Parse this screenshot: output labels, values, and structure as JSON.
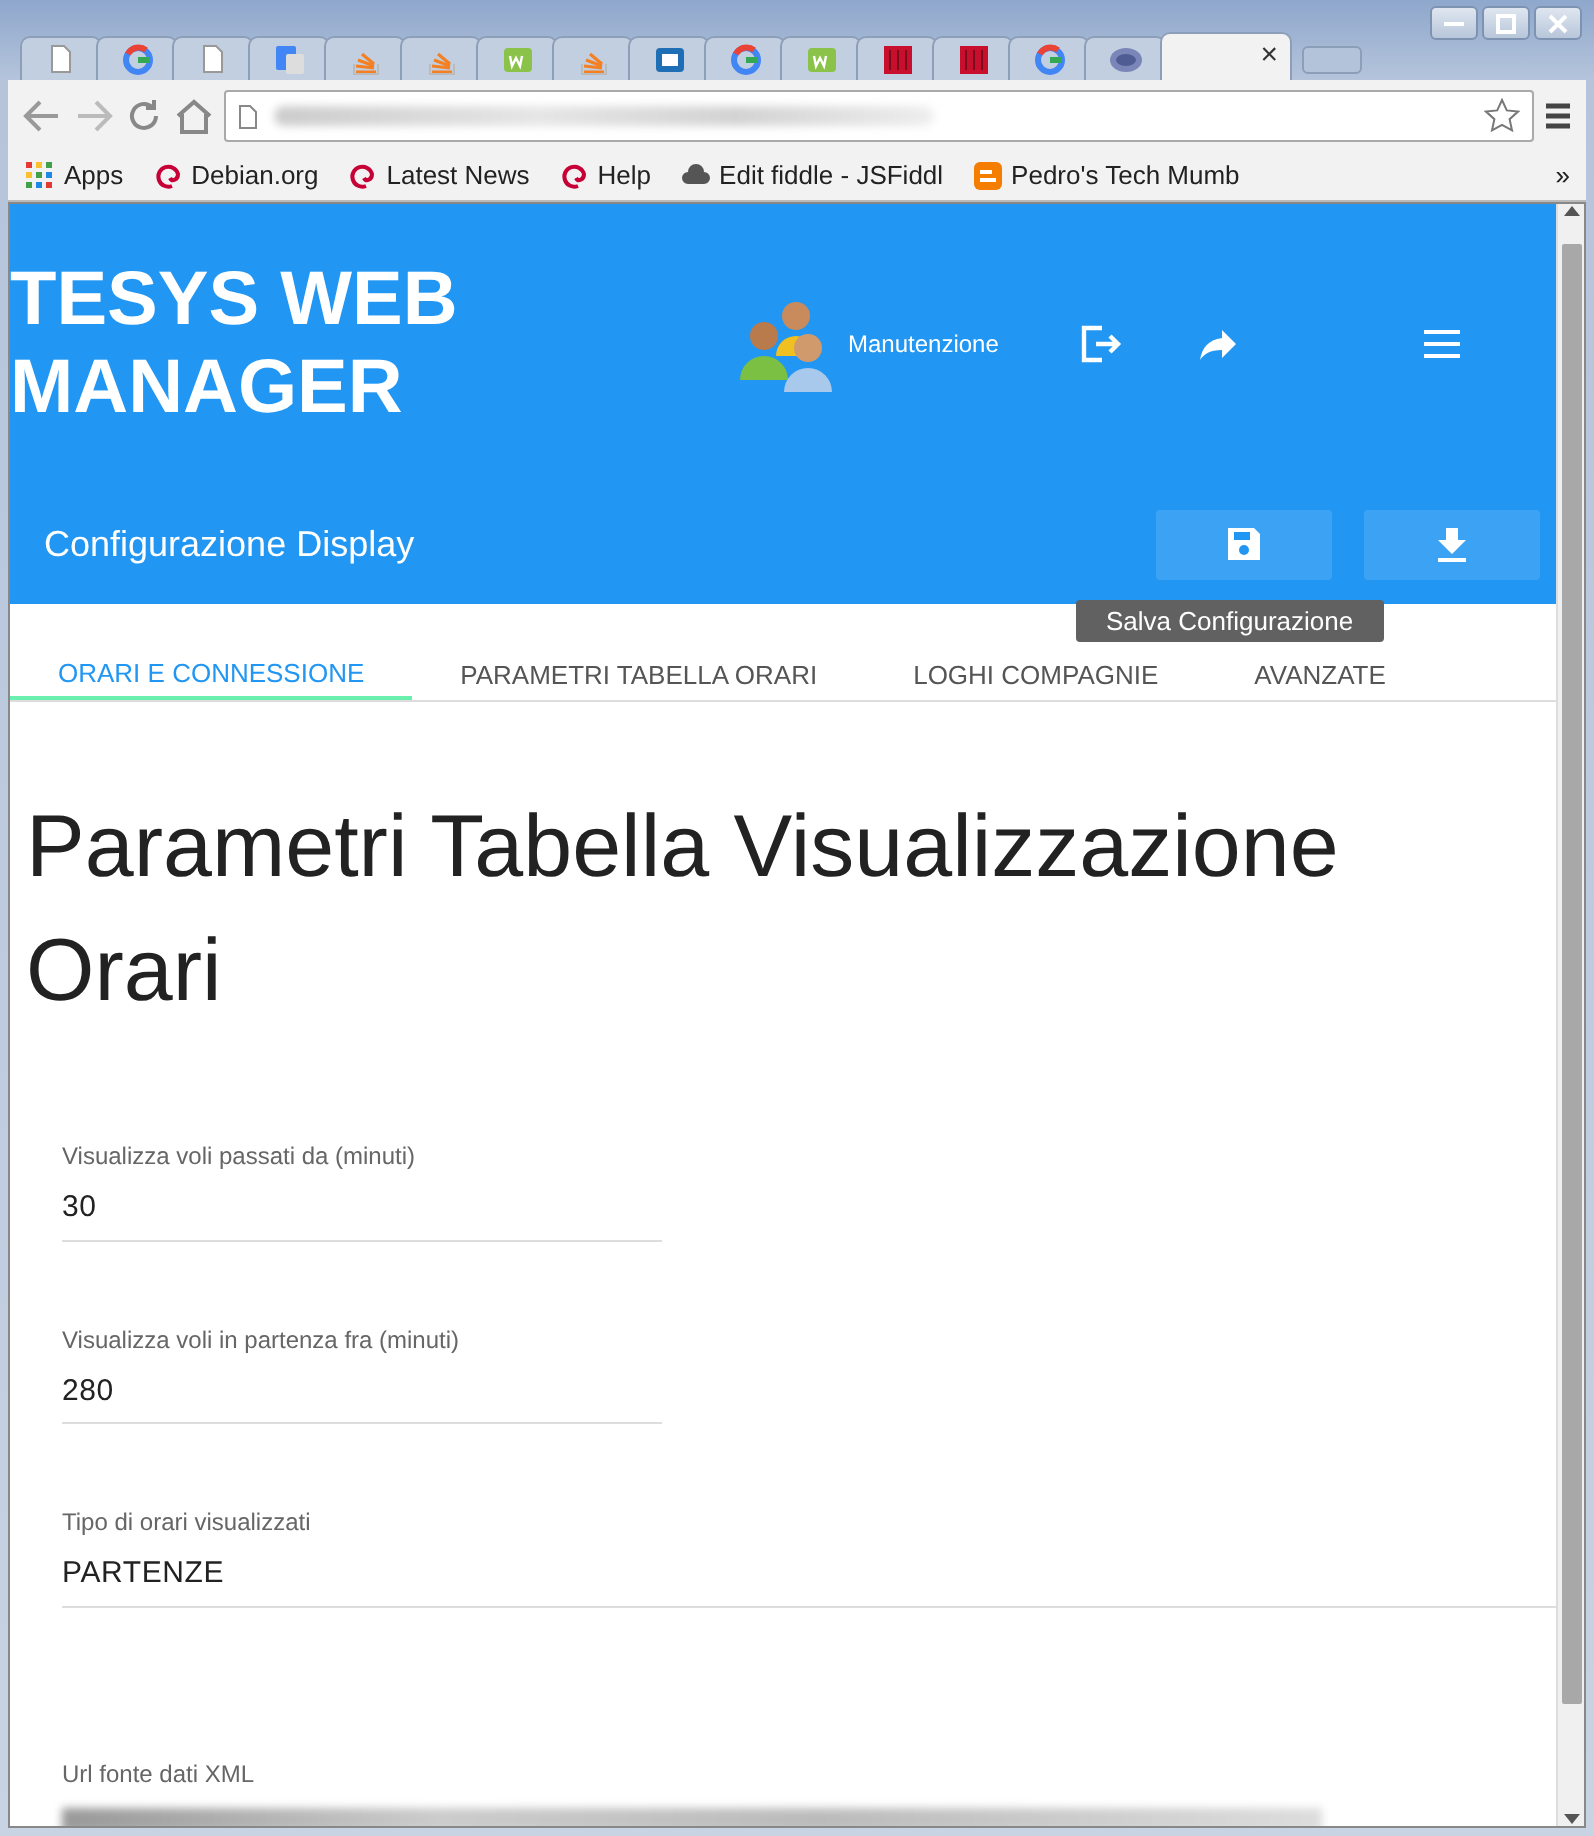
{
  "browser": {
    "tabs": [
      {
        "kind": "page",
        "selected": false
      },
      {
        "kind": "google",
        "selected": false
      },
      {
        "kind": "page",
        "selected": false
      },
      {
        "kind": "translate",
        "selected": false
      },
      {
        "kind": "stack",
        "selected": false
      },
      {
        "kind": "stack",
        "selected": false
      },
      {
        "kind": "w3",
        "selected": false
      },
      {
        "kind": "stack",
        "selected": false
      },
      {
        "kind": "box",
        "selected": false
      },
      {
        "kind": "google",
        "selected": false
      },
      {
        "kind": "w3",
        "selected": false
      },
      {
        "kind": "grid",
        "selected": false
      },
      {
        "kind": "grid",
        "selected": false
      },
      {
        "kind": "google",
        "selected": false
      },
      {
        "kind": "php",
        "selected": false
      },
      {
        "kind": "blank",
        "selected": true
      }
    ],
    "close_tab": "×",
    "bookmarks": [
      {
        "kind": "apps",
        "label": "Apps"
      },
      {
        "kind": "debian",
        "label": "Debian.org"
      },
      {
        "kind": "debian",
        "label": "Latest News"
      },
      {
        "kind": "debian",
        "label": "Help"
      },
      {
        "kind": "cloud",
        "label": "Edit fiddle - JSFiddl"
      },
      {
        "kind": "blogger",
        "label": "Pedro's Tech Mumb"
      }
    ],
    "bookmarks_overflow": "»"
  },
  "app": {
    "title": "TESYS WEB MANAGER",
    "user": "Manutenzione",
    "section": "Configurazione Display",
    "tooltip": "Salva Configurazione",
    "tabs": [
      {
        "label": "ORARI E CONNESSIONE",
        "selected": true
      },
      {
        "label": "PARAMETRI TABELLA ORARI",
        "selected": false
      },
      {
        "label": "LOGHI COMPAGNIE",
        "selected": false
      },
      {
        "label": "AVANZATE",
        "selected": false
      }
    ],
    "heading": "Parametri Tabella Visualizzazione Orari",
    "fields": [
      {
        "label": "Visualizza voli passati da (minuti)",
        "value": "30",
        "kind": "short"
      },
      {
        "label": "Visualizza voli in partenza fra (minuti)",
        "value": "280",
        "kind": "short"
      },
      {
        "label": "Tipo di orari visualizzati",
        "value": "PARTENZE",
        "kind": "wide"
      },
      {
        "label": "Url fonte dati XML",
        "kind": "redacted"
      }
    ]
  }
}
